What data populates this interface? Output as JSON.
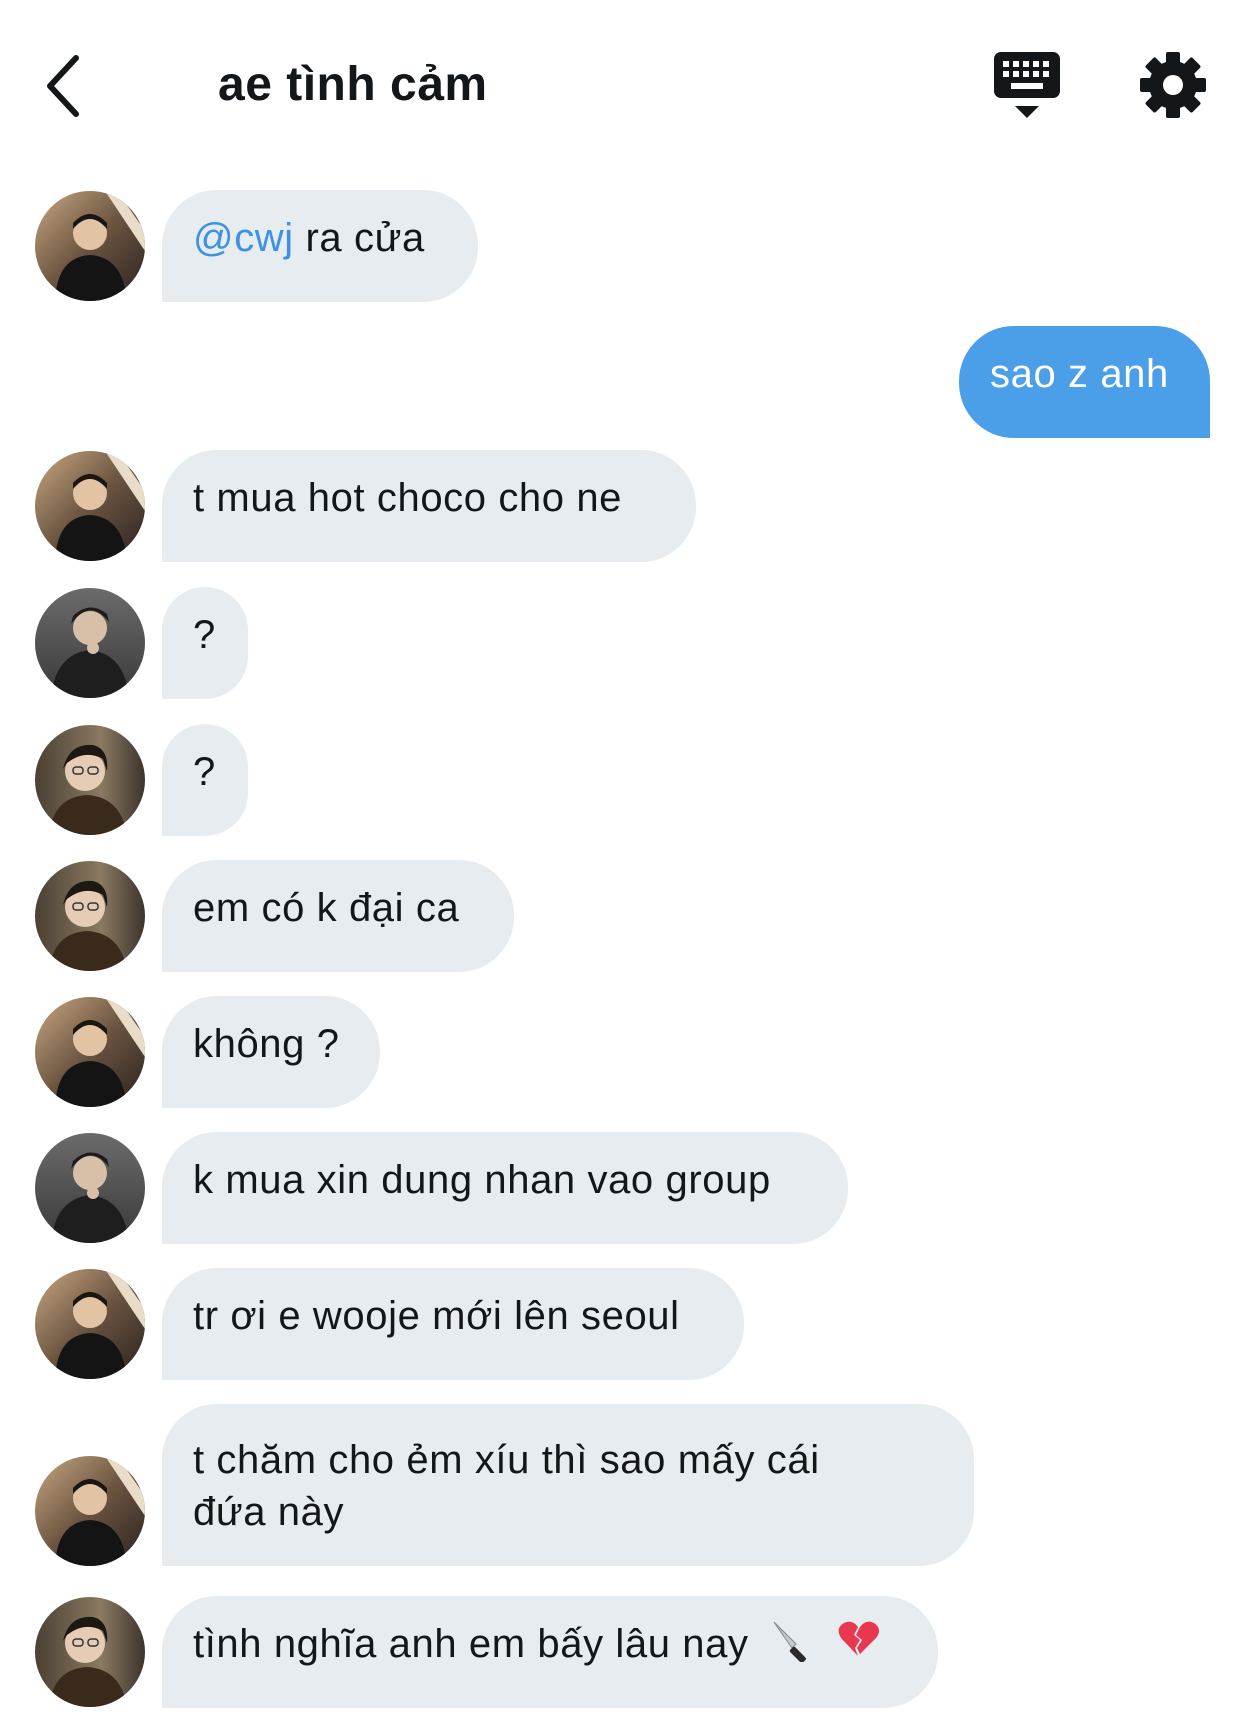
{
  "header": {
    "title": "ae tình cảm",
    "back_icon": "chevron-left-icon",
    "keyboard_icon": "keyboard-hide-icon",
    "settings_icon": "gear-icon"
  },
  "colors": {
    "bubble_incoming": "#e6ecf0",
    "bubble_outgoing": "#4a9fe8",
    "mention": "#3d92e4",
    "text": "#14171a"
  },
  "messages": [
    {
      "sender": "a",
      "mention": "@cwj",
      "text": " ra cửa"
    },
    {
      "sender": "me",
      "text": "sao z anh"
    },
    {
      "sender": "a",
      "text": "t mua hot choco cho ne"
    },
    {
      "sender": "b",
      "text": "?"
    },
    {
      "sender": "c",
      "text": "?"
    },
    {
      "sender": "c",
      "text": "em có k đại ca"
    },
    {
      "sender": "a",
      "text": "không ?"
    },
    {
      "sender": "b",
      "text": "k mua xin dung nhan vao group"
    },
    {
      "sender": "a",
      "text": "tr ơi e wooje mới lên seoul"
    },
    {
      "sender": "a",
      "line1": "t chăm cho ẻm xíu thì sao mấy cái",
      "line2": "đứa này"
    },
    {
      "sender": "c",
      "text": "tình nghĩa anh em bấy lâu nay",
      "emojis": [
        "knife-icon",
        "broken-heart-icon"
      ]
    }
  ]
}
